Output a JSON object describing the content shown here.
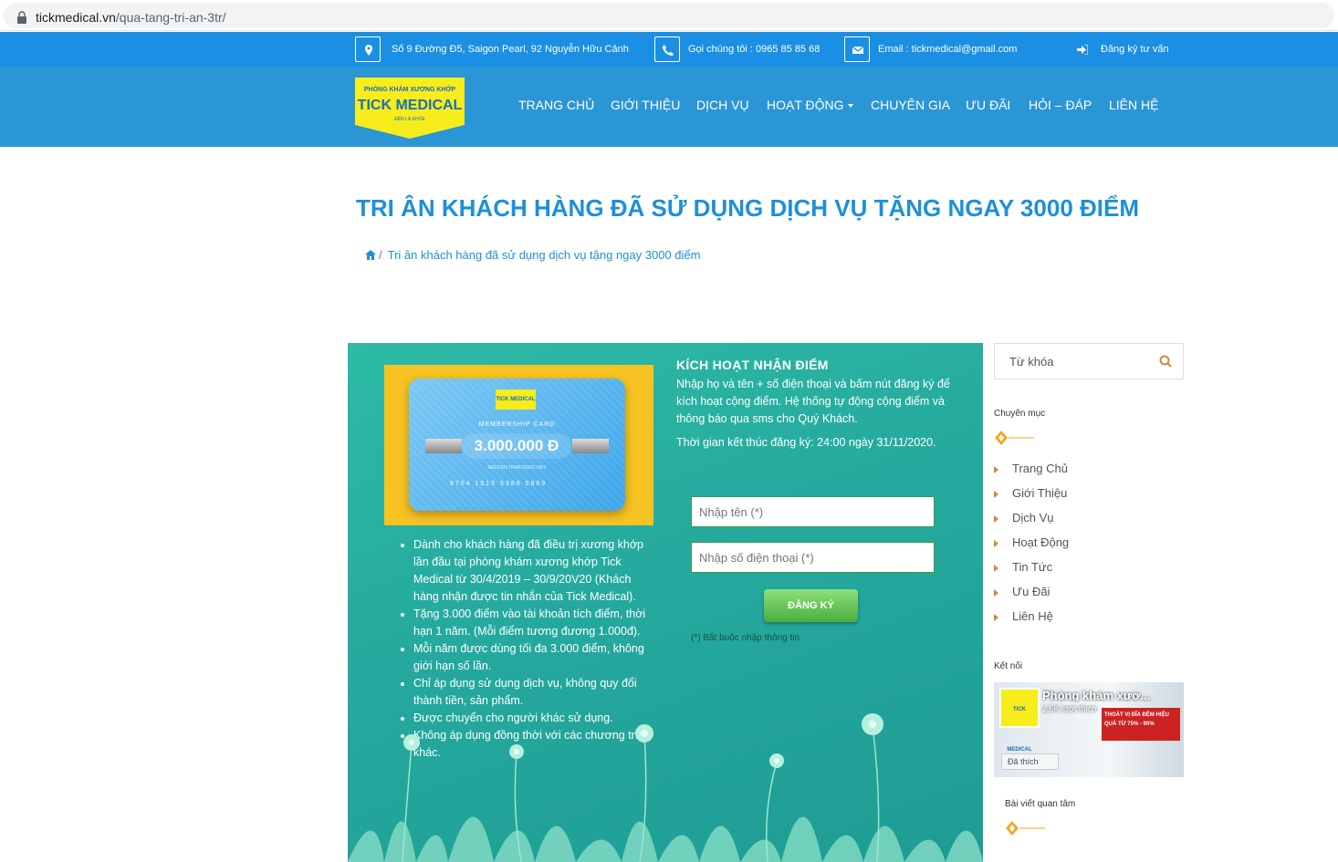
{
  "browser": {
    "url_domain": "tickmedical.vn",
    "url_path": "/qua-tang-tri-an-3tr/"
  },
  "topbar": {
    "address_icon": "map-marker-icon",
    "address": "Số 9 Đường Đ5, Saigon Pearl, 92 Nguyễn Hữu Cảnh",
    "phone_icon": "phone-icon",
    "phone": "Gọi chúng tôi : 0965 85 85 68",
    "email_icon": "envelope-icon",
    "email": "Email : tickmedical@gmail.com",
    "consult_icon": "sign-in-icon",
    "consult": "Đăng ký tư vấn"
  },
  "logo": {
    "tagline_top": "PHÒNG KHÁM XƯƠNG KHỚP",
    "brand": "TICK MEDICAL",
    "tagline_bottom": "ĐẾN LÀ KHỎE"
  },
  "nav": {
    "items": [
      {
        "label": "TRANG CHỦ"
      },
      {
        "label": "GIỚI THIỆU"
      },
      {
        "label": "DỊCH VỤ"
      },
      {
        "label": "HOẠT ĐỘNG"
      },
      {
        "label": "CHUYÊN GIA"
      },
      {
        "label": "ƯU ĐÃI"
      },
      {
        "label": "HỎI – ĐÁP"
      },
      {
        "label": "LIÊN HỆ"
      }
    ]
  },
  "page": {
    "title": "TRI ÂN KHÁCH HÀNG ĐÃ SỬ DỤNG DỊCH VỤ TẶNG NGAY 3000 ĐIỂM",
    "breadcrumb_sep": "/",
    "breadcrumb_current": "Tri ân khách hàng đã sử dụng dịch vụ tặng ngay 3000 điểm"
  },
  "card": {
    "logo": "TICK MEDICAL",
    "label": "MEMBERSHIP CARD",
    "amount": "3.000.000 Đ",
    "owner": "NGUYEN TRAN DUOC HUY",
    "number": "9704 1515 5388 5869"
  },
  "promo": {
    "bullets": [
      "Dành cho khách hàng đã điều trị xương khớp lần đầu tại phòng khám xương khớp Tick Medical từ 30/4/2019 – 30/9/20V20 (Khách hàng nhận được tin nhắn của Tick Medical).",
      "Tặng 3.000 điểm vào tài khoản tích điểm, thời hạn 1 năm. (Mỗi điểm tương đương 1.000đ).",
      "Mỗi năm được dùng tối đa 3.000 điểm, không giới hạn số lần.",
      "Chỉ áp dụng sử dụng dịch vụ, không quy đổi thành tiền, sản phẩm.",
      "Được chuyển cho người khác sử dụng.",
      "Không áp dụng đồng thời với các chương trình khác."
    ],
    "activate_title": "KÍCH HOẠT NHẬN ĐIỂM",
    "activate_desc": "Nhập họ và tên + số điện thoại và bấm nút đăng ký để kích hoạt cộng điểm. Hệ thống tự động cộng điểm và thông báo qua sms cho Quý Khách.",
    "deadline": "Thời gian kết thúc đăng ký: 24:00 ngày 31/11/2020.",
    "name_placeholder": "Nhập tên (*)",
    "phone_placeholder": "Nhập số điện thoại (*)",
    "submit": "ĐĂNG KÝ",
    "required_note": "(*) Bắt buộc nhập thông tin"
  },
  "sidebar": {
    "search_placeholder": "Từ khóa",
    "categories_title": "Chuyên mục",
    "categories": [
      {
        "label": "Trang Chủ"
      },
      {
        "label": "Giới Thiệu"
      },
      {
        "label": "Dịch Vụ"
      },
      {
        "label": "Hoạt Động"
      },
      {
        "label": "Tin Tức"
      },
      {
        "label": "Ưu Đãi"
      },
      {
        "label": "Liên Hệ"
      }
    ],
    "connect_title": "Kết nối",
    "fb_page_name": "Phòng khám xươ...",
    "fb_likes": "2,6K lượt thích",
    "fb_liked": "Đã thích",
    "fb_banner_text": "THOÁT VỊ ĐĨA ĐỆM HIỆU QUẢ TỪ 75% - 90%",
    "related_title": "Bài viết quan tâm"
  },
  "colors": {
    "topbar": "#1a8fe3",
    "navbar": "#2b96d6",
    "title": "#1e90d6",
    "promo_bg": "#25a99e",
    "logo_yellow": "#f7ec1c",
    "accent_orange": "#f5a623"
  }
}
